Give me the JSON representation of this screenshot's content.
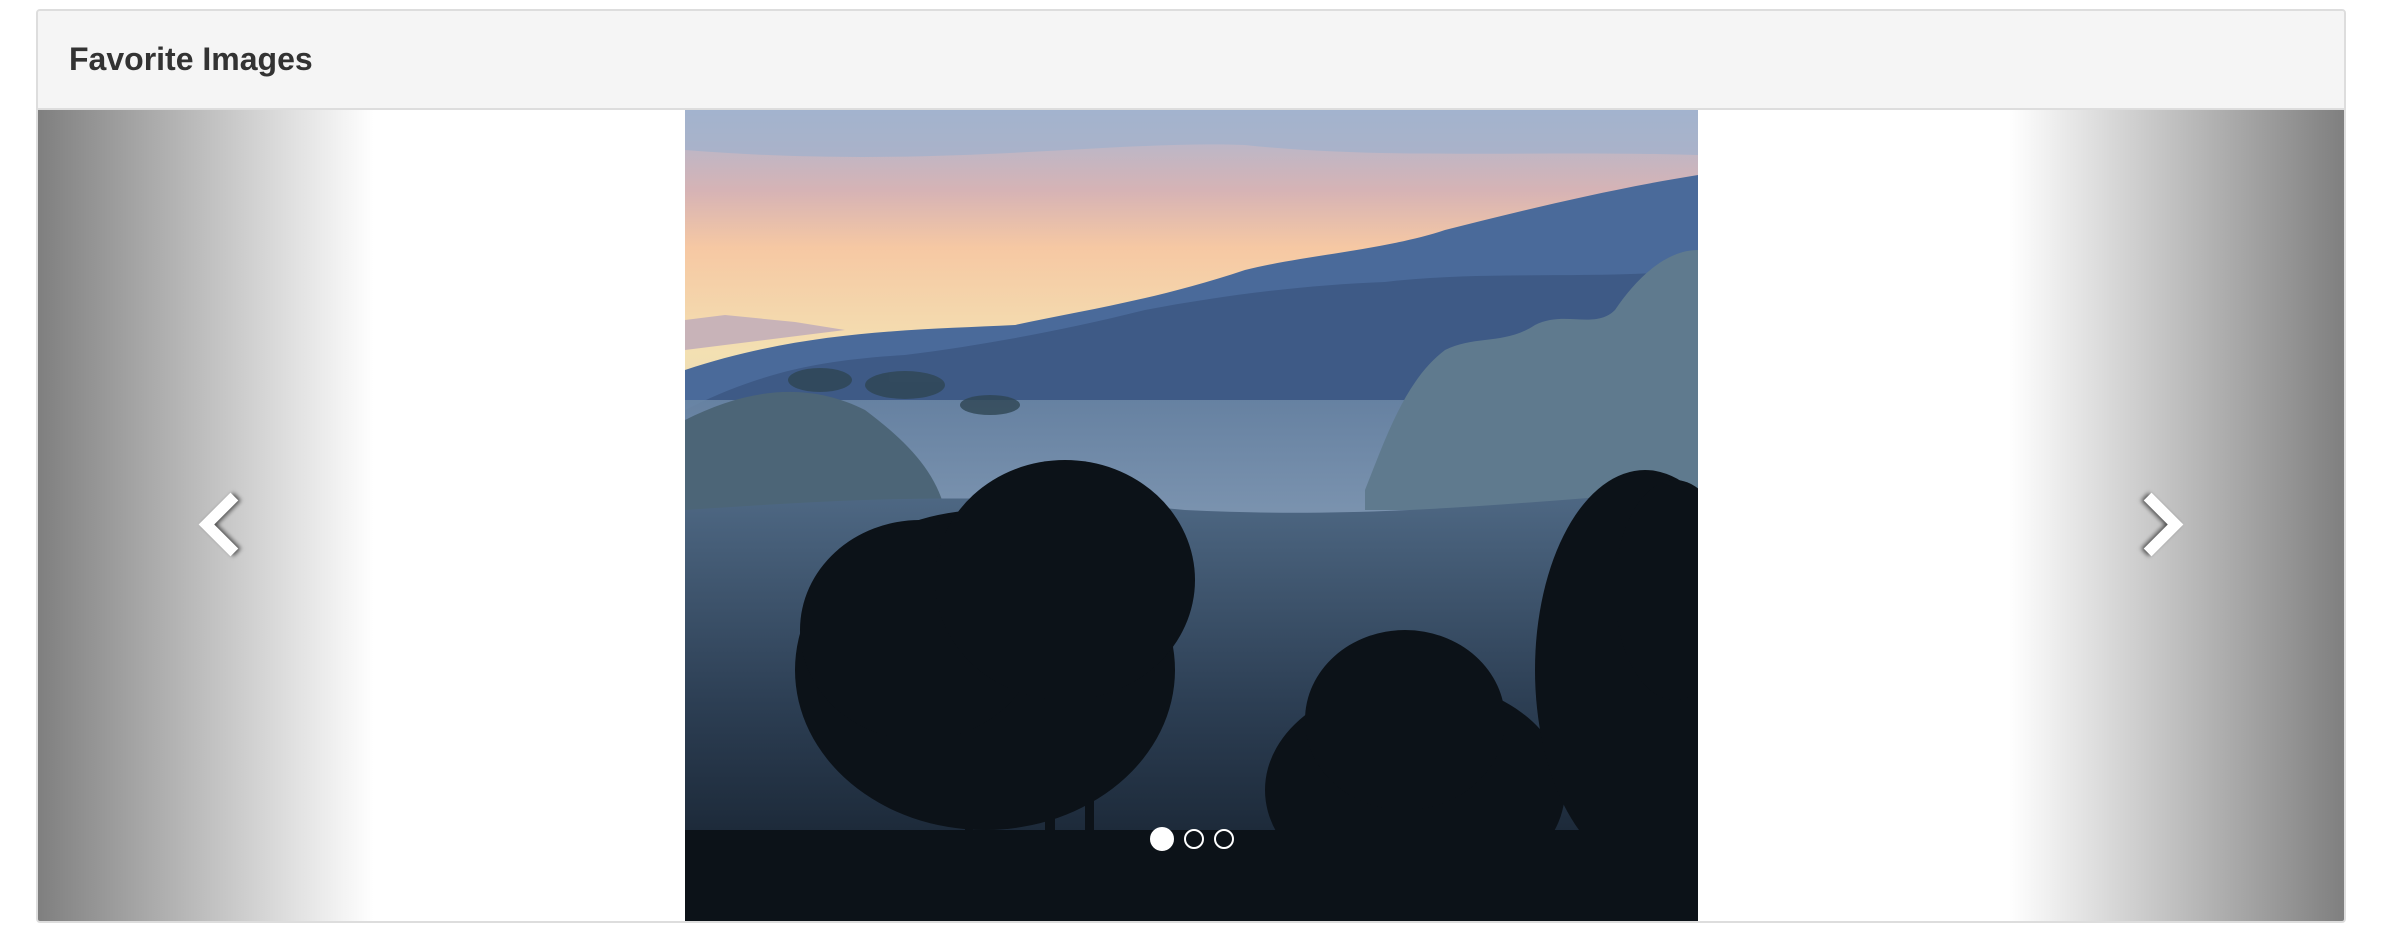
{
  "panel": {
    "title": "Favorite Images"
  },
  "carousel": {
    "prev_icon": "chevron-left-icon",
    "next_icon": "chevron-right-icon",
    "slide_image": "misty-forest-landscape",
    "slide_count": 3,
    "active_index": 0
  }
}
